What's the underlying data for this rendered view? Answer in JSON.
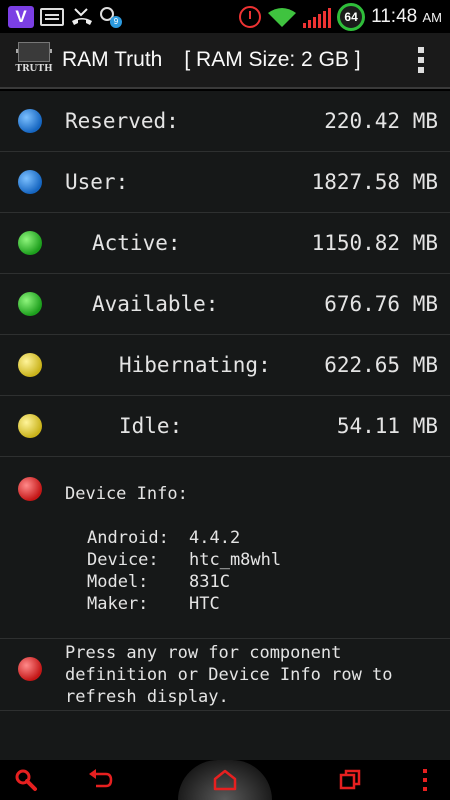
{
  "status_bar": {
    "time": "11:48",
    "ampm": "AM",
    "battery_level": "64",
    "viber_letter": "V",
    "sync_badge": "9"
  },
  "app_bar": {
    "title": "RAM Truth",
    "logo_text": "TRUTH",
    "ram_size": "[ RAM Size: 2 GB ]"
  },
  "memory_rows": [
    {
      "label": "Reserved:",
      "value": "220.42 MB",
      "color": "blue"
    },
    {
      "label": "User:",
      "value": "1827.58 MB",
      "color": "blue"
    },
    {
      "label": "Active:",
      "value": "1150.82 MB",
      "color": "green"
    },
    {
      "label": "Available:",
      "value": "676.76 MB",
      "color": "green"
    },
    {
      "label": "Hibernating:",
      "value": "622.65 MB",
      "color": "yellow"
    },
    {
      "label": "Idle:",
      "value": "54.11 MB",
      "color": "yellow"
    }
  ],
  "device_info": {
    "title": "Device Info:",
    "lines": [
      {
        "key": "Android:",
        "value": "4.4.2"
      },
      {
        "key": "Device:",
        "value": "htc_m8whl"
      },
      {
        "key": "Model:",
        "value": "831C"
      },
      {
        "key": "Maker:",
        "value": "HTC"
      }
    ]
  },
  "help_text": "Press any row for component definition or Device Info row to refresh display.",
  "colors": {
    "blue": "#1565c0",
    "green": "#1c9e1c",
    "yellow": "#c9b21a",
    "red": "#c41616",
    "nav_accent": "#e62020"
  },
  "nav_bar": {
    "items": [
      "search-icon",
      "back-icon",
      "home-icon",
      "recent-apps-icon",
      "overflow-menu-icon"
    ]
  }
}
